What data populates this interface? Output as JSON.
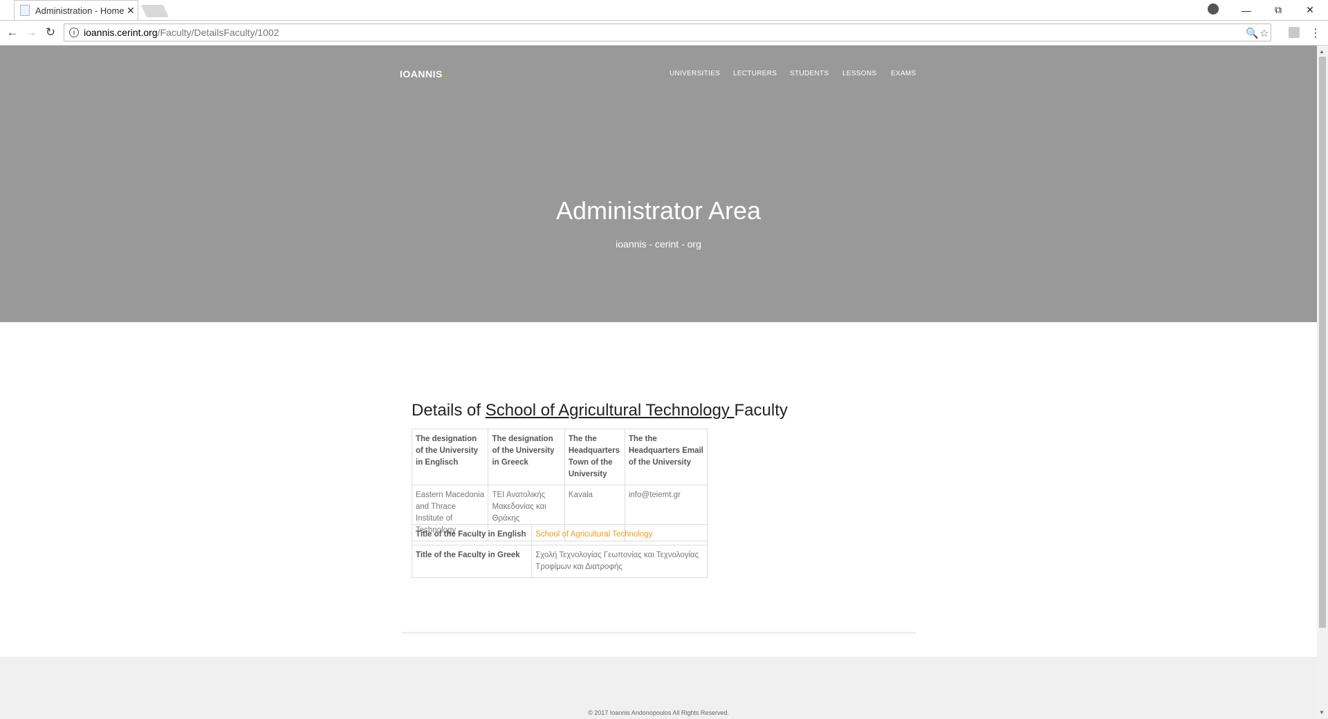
{
  "browser": {
    "tab_title": "Administration - Home - ",
    "tab_close": "✕",
    "url_host": "ioannis.cerint.org",
    "url_path": "/Faculty/DetailsFaculty/1002"
  },
  "site": {
    "logo": "IOANNIS",
    "logo_dot": ".",
    "nav": [
      "UNIVERSITIES",
      "LECTURERS",
      "STUDENTS",
      "LESSONS",
      "EXAMS"
    ],
    "hero_title": "Administrator Area",
    "hero_subtitle": "ioannis - cerint - org"
  },
  "details": {
    "prefix": "Details of ",
    "faculty_link": "School of Agricultural Technology ",
    "suffix": "Faculty",
    "university_table": {
      "headers": [
        "The designation of the University in Englisch",
        "The designation of the University in Greeck",
        "The the Headquarters Town of the University",
        "The the Headquarters Email of the University"
      ],
      "row": [
        "Eastern Macedonia and Thrace Institute of Technology",
        "ΤΕΙ Ανατολικής Μακεδονίας και Θράκης",
        "Kavala",
        "info@teiemt.gr"
      ]
    },
    "faculty_table": {
      "english_label": "Title of the Faculty in English",
      "english_value": "School of Agricultural Technology",
      "greek_label": "Title of the Faculty in Greek",
      "greek_value": "Σχολή Τεχνολογίας Γεωπονίας και Τεχνολογίας Τροφίμων και Διατροφής"
    }
  },
  "footer": {
    "copyright": "© 2017 Ioannis Andonopoulos All Rights Reserved."
  },
  "colors": {
    "hero_bg": "#999999",
    "accent": "#f29a1b",
    "footer_bg": "#f0f0f0"
  }
}
